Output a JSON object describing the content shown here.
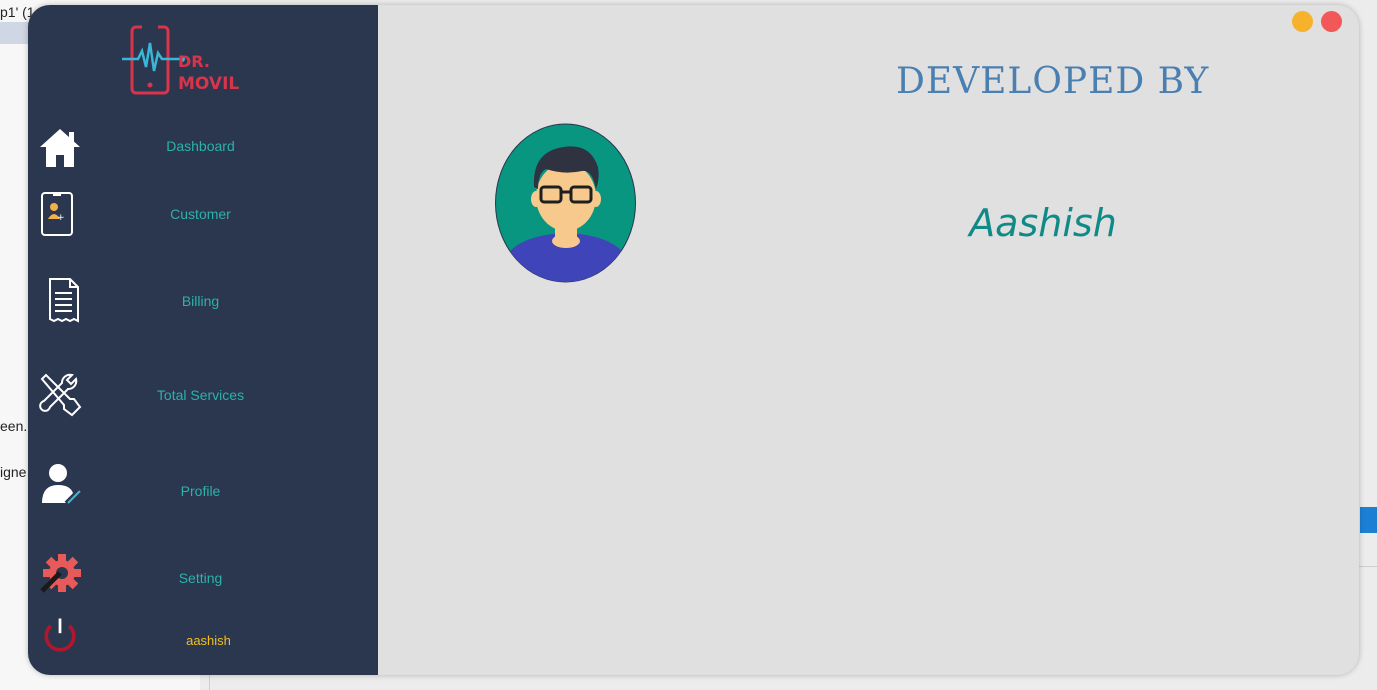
{
  "background": {
    "text_line1": "p1' (1",
    "text_line2": "een.",
    "text_line3": "igne"
  },
  "colors": {
    "sidebar": "#2b364f",
    "main": "#e0e0e0",
    "accent_teal": "#2bb3a8",
    "title_blue": "#4a7fb2",
    "name_teal": "#108a87",
    "user_yellow": "#f0c020",
    "minimize": "#f6b22b",
    "close": "#f25858"
  },
  "window_controls": {
    "minimize_icon": "minimize-icon",
    "close_icon": "close-icon"
  },
  "logo": {
    "line1": "DR.",
    "line2": "MOVIL"
  },
  "sidebar": {
    "items": [
      {
        "label": "Dashboard",
        "icon": "home-icon"
      },
      {
        "label": "Customer",
        "icon": "customer-phone-icon"
      },
      {
        "label": "Billing",
        "icon": "receipt-icon"
      },
      {
        "label": "Total Services",
        "icon": "tools-icon"
      },
      {
        "label": "Profile",
        "icon": "profile-icon"
      },
      {
        "label": "Setting",
        "icon": "gear-icon"
      }
    ],
    "user": {
      "label": "aashish",
      "icon": "power-icon"
    }
  },
  "main": {
    "title": "Developed By",
    "developer_name": "Aashish",
    "avatar_icon": "developer-avatar"
  }
}
